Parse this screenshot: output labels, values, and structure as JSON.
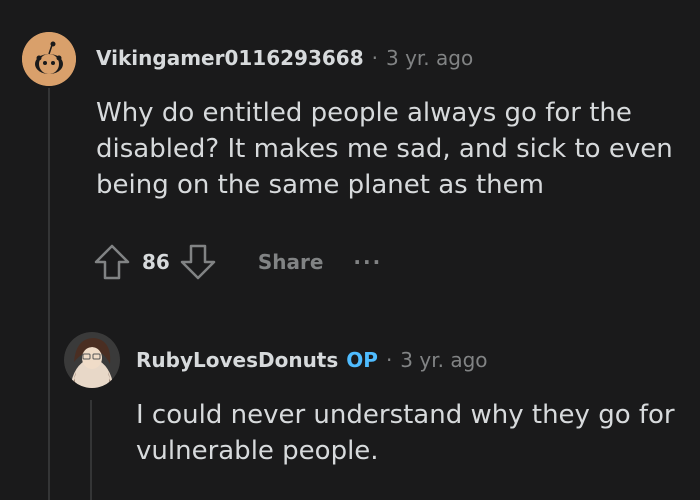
{
  "comments": [
    {
      "username": "Vikingamer0116293668",
      "separator": "·",
      "time": "3 yr. ago",
      "body": "Why do entitled people always go for the\ndisabled? It makes me sad, and sick to even\nbeing on the same planet as them",
      "votes": "86",
      "share_label": "Share",
      "more_label": "···",
      "avatar_icon": "reddit-snoo-avatar",
      "avatar_color": "#d9a06b"
    },
    {
      "username": "RubyLovesDonuts",
      "op_badge": "OP",
      "separator": "·",
      "time": "3 yr. ago",
      "body": "I could never understand why they go for\nvulnerable people.",
      "avatar_icon": "anime-character-avatar"
    }
  ],
  "colors": {
    "background": "#1a1a1b",
    "text": "#d7dadc",
    "muted": "#818384",
    "op": "#4fbcff",
    "thread_line": "#343536"
  }
}
